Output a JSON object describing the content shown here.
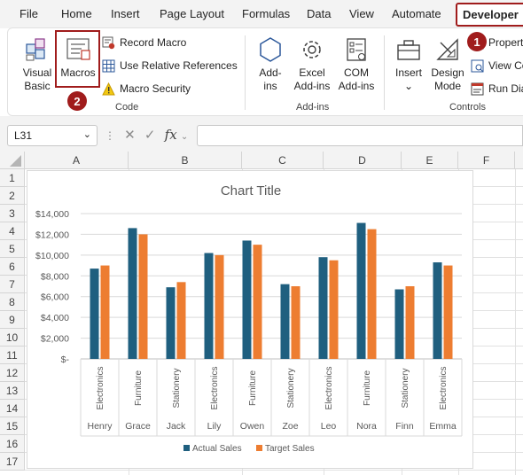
{
  "menu": {
    "tabs": [
      "File",
      "Home",
      "Insert",
      "Page Layout",
      "Formulas",
      "Data",
      "View",
      "Automate",
      "Developer"
    ],
    "active": "Developer"
  },
  "ribbon": {
    "code": {
      "label": "Code",
      "visual_basic_line1": "Visual",
      "visual_basic_line2": "Basic",
      "macros": "Macros",
      "record_macro": "Record Macro",
      "use_relative_references": "Use Relative References",
      "macro_security": "Macro Security"
    },
    "addins": {
      "label": "Add-ins",
      "addins_line1": "Add-",
      "addins_line2": "ins",
      "excel_addins_line1": "Excel",
      "excel_addins_line2": "Add-ins",
      "com_addins_line1": "COM",
      "com_addins_line2": "Add-ins"
    },
    "controls": {
      "label": "Controls",
      "insert": "Insert",
      "design_mode_line1": "Design",
      "design_mode_line2": "Mode",
      "properties": "Propert",
      "view_code": "View Co",
      "run_dialog": "Run Dia"
    }
  },
  "steps": {
    "one": "1",
    "two": "2"
  },
  "formula_bar": {
    "name_box": "L31",
    "fx": "fx",
    "formula": ""
  },
  "sheet": {
    "columns": [
      "A",
      "B",
      "C",
      "D",
      "E",
      "F"
    ],
    "rows": [
      "1",
      "2",
      "3",
      "4",
      "5",
      "6",
      "7",
      "8",
      "9",
      "10",
      "11",
      "12",
      "13",
      "14",
      "15",
      "16",
      "17"
    ]
  },
  "colors": {
    "actual": "#1f5f7f",
    "target": "#ed7d31",
    "accent": "#a01c1c"
  },
  "chart_data": {
    "type": "bar",
    "title": "Chart Title",
    "categories": [
      [
        "Henry",
        "Electronics"
      ],
      [
        "Grace",
        "Furniture"
      ],
      [
        "Jack",
        "Stationery"
      ],
      [
        "Lily",
        "Electronics"
      ],
      [
        "Owen",
        "Furniture"
      ],
      [
        "Zoe",
        "Stationery"
      ],
      [
        "Leo",
        "Electronics"
      ],
      [
        "Nora",
        "Furniture"
      ],
      [
        "Finn",
        "Stationery"
      ],
      [
        "Emma",
        "Electronics"
      ]
    ],
    "series": [
      {
        "name": "Actual Sales",
        "color": "#1f5f7f",
        "values": [
          8700,
          12600,
          6900,
          10200,
          11400,
          7200,
          9800,
          13100,
          6700,
          9300
        ]
      },
      {
        "name": "Target Sales",
        "color": "#ed7d31",
        "values": [
          9000,
          12000,
          7400,
          10000,
          11000,
          7000,
          9500,
          12500,
          7000,
          9000
        ]
      }
    ],
    "y_ticks": [
      "$-",
      "$2,000",
      "$4,000",
      "$6,000",
      "$8,000",
      "$10,000",
      "$12,000",
      "$14,000"
    ],
    "ylim": [
      0,
      14000
    ],
    "grid": true,
    "legend": "bottom"
  }
}
